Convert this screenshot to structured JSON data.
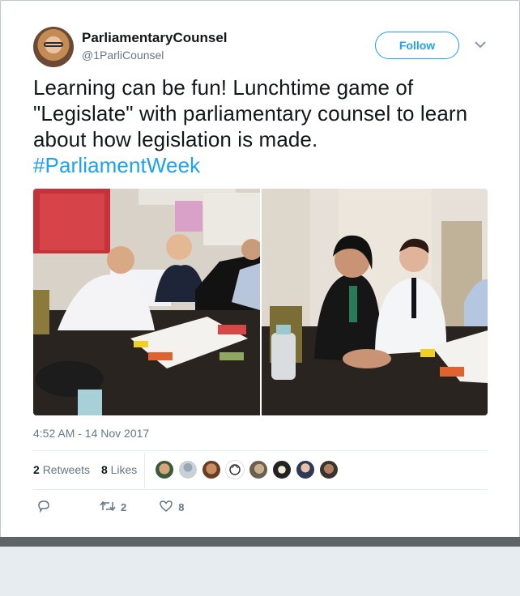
{
  "author": {
    "name": "ParliamentaryCounsel",
    "handle": "@1ParliCounsel"
  },
  "follow_label": "Follow",
  "tweet": {
    "text": "Learning can be fun! Lunchtime  game of \"Legislate\" with parliamentary counsel to learn about how legislation is made.",
    "hashtag": "#ParliamentWeek"
  },
  "timestamp": "4:52 AM - 14 Nov 2017",
  "stats": {
    "retweets_count": "2",
    "retweets_label": "Retweets",
    "likes_count": "8",
    "likes_label": "Likes"
  },
  "actions": {
    "retweet_count": "2",
    "like_count": "8"
  },
  "icons": {
    "reply": "reply-icon",
    "retweet": "retweet-icon",
    "like": "heart-icon",
    "menu": "chevron-down-icon"
  },
  "colors": {
    "accent": "#1da1f2",
    "secondary_text": "#657786"
  }
}
